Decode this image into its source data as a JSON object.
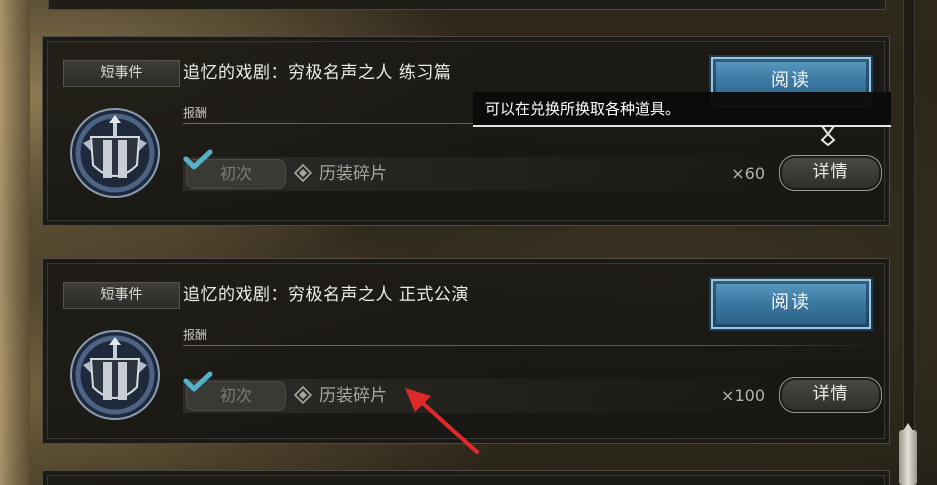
{
  "events": [
    {
      "tag": "短事件",
      "title": "追忆的戏剧：穷极名声之人  练习篇",
      "read_label": "阅读",
      "reward_label": "报酬",
      "first_label": "初次",
      "item_icon": "diamond-icon",
      "item_name": "历装碎片",
      "quantity": "×60",
      "detail_label": "详情"
    },
    {
      "tag": "短事件",
      "title": "追忆的戏剧：穷极名声之人  正式公演",
      "read_label": "阅读",
      "reward_label": "报酬",
      "first_label": "初次",
      "item_icon": "diamond-icon",
      "item_name": "历装碎片",
      "quantity": "×100",
      "detail_label": "详情"
    }
  ],
  "tooltip": {
    "text": "可以在兑换所换取各种道具。"
  },
  "colors": {
    "read_button": "#3d7aa3",
    "check": "#56b0c8",
    "annotation_arrow": "#e02a2a"
  }
}
